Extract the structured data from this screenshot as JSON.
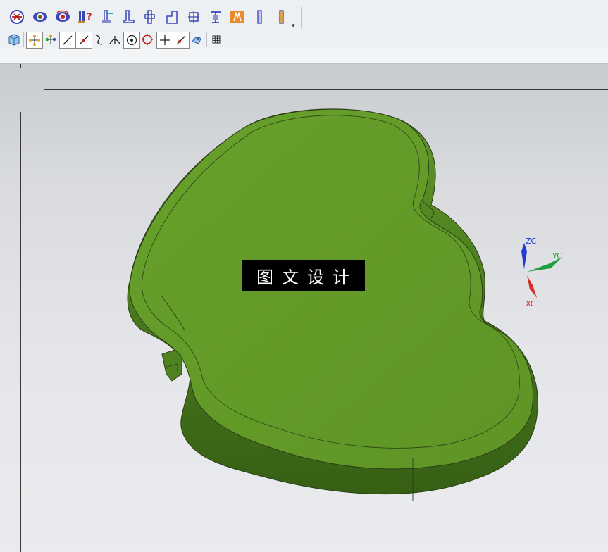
{
  "toolbar_row1": {
    "buttons": [
      {
        "name": "section-plane-button",
        "icon": "section-plane-icon"
      },
      {
        "name": "view-orient-button",
        "icon": "eye-target-icon"
      },
      {
        "name": "view-rotate-button",
        "icon": "eye-rotate-icon"
      },
      {
        "name": "check-pins-button",
        "icon": "pins-question-icon"
      },
      {
        "name": "pin-tool-button",
        "icon": "pin-tool-icon"
      },
      {
        "name": "slot-tool-button",
        "icon": "slot-tool-icon"
      },
      {
        "name": "bolt-tool-button",
        "icon": "bolt-tool-icon"
      },
      {
        "name": "step-tool-button",
        "icon": "step-tool-icon"
      },
      {
        "name": "gear-tool-button",
        "icon": "gear-tool-icon"
      },
      {
        "name": "post-tool-button",
        "icon": "post-tool-icon"
      },
      {
        "name": "color-block-button",
        "icon": "color-block-icon"
      },
      {
        "name": "bar-tool-button",
        "icon": "bar-tool-icon"
      },
      {
        "name": "bar2-tool-button",
        "icon": "bar2-tool-icon"
      }
    ],
    "more_glyph": "▾"
  },
  "toolbar_row2": {
    "buttons": [
      {
        "name": "solid-cube-button",
        "icon": "cube-icon"
      },
      {
        "name": "snap-vertices-button",
        "icon": "snap-vertices-icon"
      },
      {
        "name": "snap-move-button",
        "icon": "snap-move-icon"
      },
      {
        "name": "line-end-button",
        "icon": "line-end-icon"
      },
      {
        "name": "line-mid-button",
        "icon": "line-mid-icon"
      },
      {
        "name": "curve-button",
        "icon": "curve-icon"
      },
      {
        "name": "intersection-button",
        "icon": "intersection-icon"
      },
      {
        "name": "arc-center-button",
        "icon": "arc-center-icon"
      },
      {
        "name": "quadrant-button",
        "icon": "quadrant-icon"
      },
      {
        "name": "point-on-curve-button",
        "icon": "crosshair-icon"
      },
      {
        "name": "point-on-face-button",
        "icon": "point-on-face-icon"
      },
      {
        "name": "bounded-grid-button",
        "icon": "bounded-grid-icon"
      },
      {
        "name": "grid-button",
        "icon": "grid-icon"
      }
    ]
  },
  "watermark": {
    "text": "图文设计"
  },
  "triad": {
    "zc": "ZC",
    "yc": "YC",
    "xc": "XC",
    "colors": {
      "z": "#1f3bd1",
      "y": "#1fa03c",
      "x": "#d92828"
    }
  },
  "model": {
    "top_color": "#64992a",
    "side_color": "#4f8220"
  }
}
